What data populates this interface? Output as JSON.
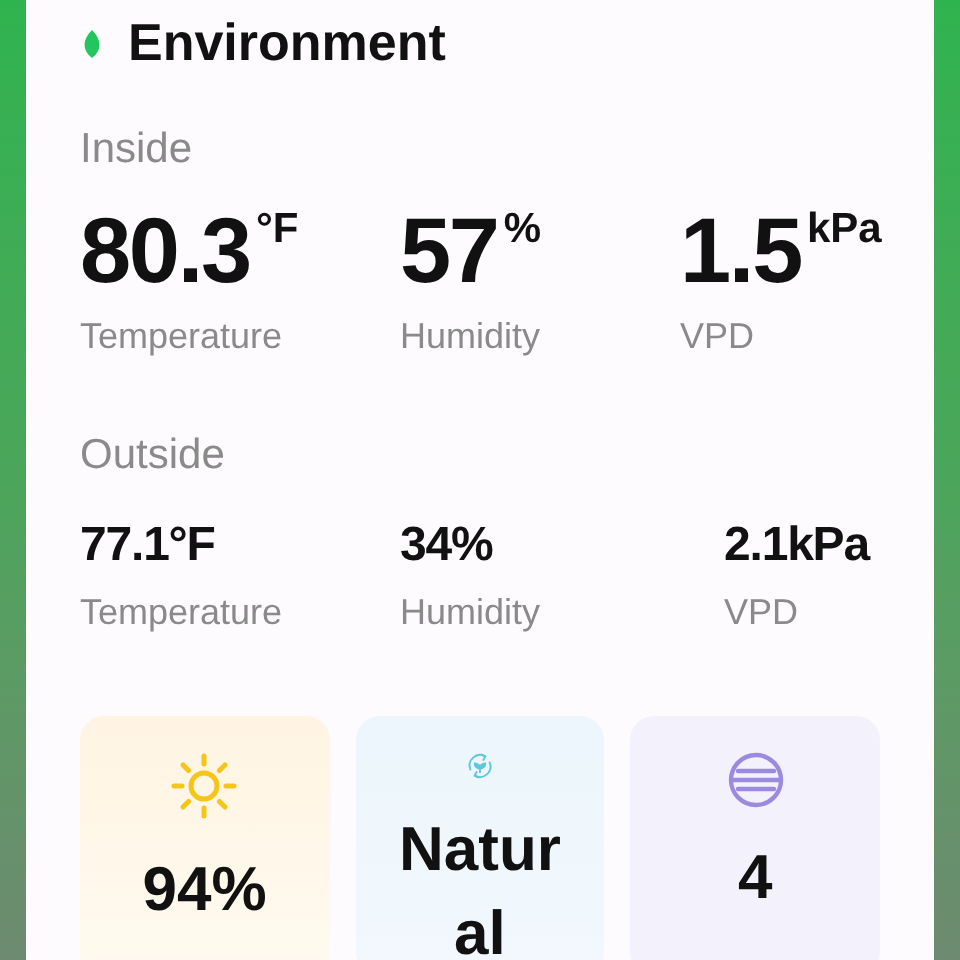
{
  "title": "Environment",
  "inside": {
    "heading": "Inside",
    "metrics": [
      {
        "value": "80.3",
        "unit": "°F",
        "label": "Temperature"
      },
      {
        "value": "57",
        "unit": "%",
        "label": "Humidity"
      },
      {
        "value": "1.5",
        "unit": "kPa",
        "label": "VPD"
      }
    ]
  },
  "outside": {
    "heading": "Outside",
    "metrics": [
      {
        "value": "77.1°F",
        "label": "Temperature"
      },
      {
        "value": "34%",
        "label": "Humidity"
      },
      {
        "value": "2.1kPa",
        "label": "VPD"
      }
    ]
  },
  "tiles": [
    {
      "kind": "light",
      "value": "94%"
    },
    {
      "kind": "mode",
      "value": "Natural"
    },
    {
      "kind": "level",
      "value": "4"
    }
  ]
}
